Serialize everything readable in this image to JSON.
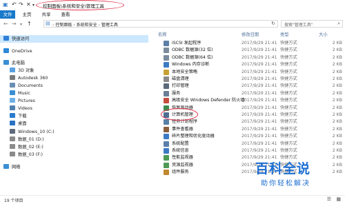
{
  "title_bar": {
    "path": "控制面板\\系统和安全\\管理工具",
    "quick_access": [
      "↶",
      "↷",
      "✕",
      "▾"
    ]
  },
  "ribbon": {
    "tabs": [
      "文件",
      "主页",
      "共享",
      "查看"
    ]
  },
  "address": {
    "crumbs": [
      "控制面板",
      "系统和安全",
      "管理工具"
    ],
    "search_placeholder": "搜索\"管理工具\""
  },
  "nav": {
    "items": [
      {
        "label": "快速访问",
        "icon": "star-icon",
        "color": "#2f7ed8",
        "selected": true
      },
      {
        "label": "OneDrive",
        "icon": "cloud-icon",
        "color": "#2b88d8"
      },
      {
        "label": "此电脑",
        "icon": "computer-icon",
        "color": "#3a8ed3"
      },
      {
        "label": "3D 对象",
        "icon": "cube-icon",
        "color": "#5aa0e0"
      },
      {
        "label": "Autodesk 360",
        "icon": "autodesk-icon",
        "color": "#7a7a7a"
      },
      {
        "label": "Documents",
        "icon": "documents-icon",
        "color": "#6a8fb5"
      },
      {
        "label": "Music",
        "icon": "music-icon",
        "color": "#3a8ed3"
      },
      {
        "label": "Pictures",
        "icon": "pictures-icon",
        "color": "#6fb0e8"
      },
      {
        "label": "Videos",
        "icon": "videos-icon",
        "color": "#4f7fb0"
      },
      {
        "label": "下载",
        "icon": "download-icon",
        "color": "#2a7ad0"
      },
      {
        "label": "桌面",
        "icon": "desktop-icon",
        "color": "#2a72c4"
      },
      {
        "label": "Windows_10 (C:)",
        "icon": "drive-icon",
        "color": "#5d6b7a"
      },
      {
        "label": "数据_01 (D:)",
        "icon": "drive-icon",
        "color": "#8a8a8a"
      },
      {
        "label": "数据_02 (E:)",
        "icon": "drive-icon",
        "color": "#8a8a8a"
      },
      {
        "label": "数据_03 (F:)",
        "icon": "drive-icon",
        "color": "#8a8a8a"
      },
      {
        "label": "网络",
        "icon": "network-icon",
        "color": "#3a8ed3"
      }
    ]
  },
  "columns": {
    "name": "名称",
    "date": "修改日期",
    "type": "类型",
    "size": "大小"
  },
  "files": [
    {
      "name": "iSCSI 发起程序",
      "date": "2017/9/29 21:41",
      "type": "快捷方式",
      "size": "2 KB",
      "icon_color": "#5b7fa8"
    },
    {
      "name": "ODBC 数据源(32 位)",
      "date": "2017/9/29 21:41",
      "type": "快捷方式",
      "size": "2 KB",
      "icon_color": "#7a8b9c"
    },
    {
      "name": "ODBC 数据源(64 位)",
      "date": "2017/9/29 21:41",
      "type": "快捷方式",
      "size": "2 KB",
      "icon_color": "#7a8b9c"
    },
    {
      "name": "Windows 内存诊断",
      "date": "2017/9/29 21:41",
      "type": "快捷方式",
      "size": "2 KB",
      "icon_color": "#3c7bc4"
    },
    {
      "name": "本地安全策略",
      "date": "2017/9/29 21:41",
      "type": "快捷方式",
      "size": "2 KB",
      "icon_color": "#c9a235"
    },
    {
      "name": "磁盘清理",
      "date": "2017/9/29 21:41",
      "type": "快捷方式",
      "size": "2 KB",
      "icon_color": "#8a8a8a"
    },
    {
      "name": "打印管理",
      "date": "2017/9/29 21:41",
      "type": "快捷方式",
      "size": "2 KB",
      "icon_color": "#5a6a7a"
    },
    {
      "name": "服务",
      "date": "2017/9/29 21:41",
      "type": "快捷方式",
      "size": "2 KB",
      "icon_color": "#6a7f96"
    },
    {
      "name": "高级安全 Windows Defender 防火墙",
      "date": "2017/9/29 21:41",
      "type": "快捷方式",
      "size": "2 KB",
      "icon_color": "#c44d3c"
    },
    {
      "name": "恢复驱动器",
      "date": "2017/9/29 21:41",
      "type": "快捷方式",
      "size": "2 KB",
      "icon_color": "#3c8a4e"
    },
    {
      "name": "计算机管理",
      "date": "2017/9/29 21:41",
      "type": "快捷方式",
      "size": "2 KB",
      "icon_color": "#4f6e93"
    },
    {
      "name": "任务计划程序",
      "date": "2017/9/29 21:41",
      "type": "快捷方式",
      "size": "2 KB",
      "icon_color": "#5a7fa6"
    },
    {
      "name": "事件查看器",
      "date": "2017/9/29 21:41",
      "type": "快捷方式",
      "size": "2 KB",
      "icon_color": "#8a5f3a"
    },
    {
      "name": "碎片整理和优化驱动器",
      "date": "2017/9/29 21:41",
      "type": "快捷方式",
      "size": "2 KB",
      "icon_color": "#3c7bc4"
    },
    {
      "name": "系统配置",
      "date": "2017/9/29 21:41",
      "type": "快捷方式",
      "size": "2 KB",
      "icon_color": "#5b7fa8"
    },
    {
      "name": "系统信息",
      "date": "2017/9/29 21:41",
      "type": "快捷方式",
      "size": "2 KB",
      "icon_color": "#3c7bc4"
    },
    {
      "name": "性能监视器",
      "date": "2017/9/29 21:41",
      "type": "快捷方式",
      "size": "2 KB",
      "icon_color": "#4e9a55"
    },
    {
      "name": "资源监视器",
      "date": "2017/9/29 21:41",
      "type": "快捷方式",
      "size": "2 KB",
      "icon_color": "#4e9a55"
    },
    {
      "name": "组件服务",
      "date": "2017/9/29 21:41",
      "type": "快捷方式",
      "size": "2 KB",
      "icon_color": "#c0882f"
    }
  ],
  "status": {
    "count": "19 个项目"
  },
  "watermark": {
    "title": "百科全说",
    "subtitle": "助你轻松解决"
  },
  "colors": {
    "accent": "#1979ca",
    "selection": "#cce8ff",
    "highlight_ellipse": "#e0314b"
  }
}
